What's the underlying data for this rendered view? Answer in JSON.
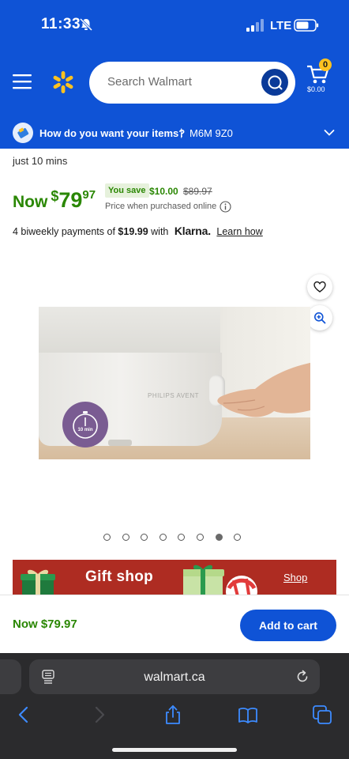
{
  "status_bar": {
    "time": "11:33",
    "network": "LTE"
  },
  "header": {
    "search_placeholder": "Search Walmart",
    "cart_count": "0",
    "cart_total": "$0.00",
    "brand_color": "#0f53d6"
  },
  "delivery": {
    "question": "How do you want your items?",
    "separator": "|",
    "postal_code": "M6M 9Z0"
  },
  "product": {
    "delivery_note": "just 10 mins",
    "price": {
      "now_label": "Now",
      "currency": "$",
      "dollars": "79",
      "cents": "97",
      "you_save_label": "You save",
      "save_amount": "$10.00",
      "was_price": "$89.97",
      "note": "Price when purchased online"
    },
    "klarna": {
      "prefix": "4 biweekly payments of",
      "amount": "$19.99",
      "with": "with",
      "logo": "Klarna.",
      "link": "Learn how"
    },
    "image": {
      "brand_text": "PHILIPS AVENT",
      "timer_label": "10 min"
    },
    "carousel": {
      "total": 8,
      "active_index": 6
    }
  },
  "banner": {
    "title": "Gift shop",
    "link": "Shop",
    "color": "#ae2c22"
  },
  "bottom_bar": {
    "price_label": "Now $79.97",
    "add_to_cart": "Add to cart"
  },
  "browser": {
    "url": "walmart.ca"
  }
}
